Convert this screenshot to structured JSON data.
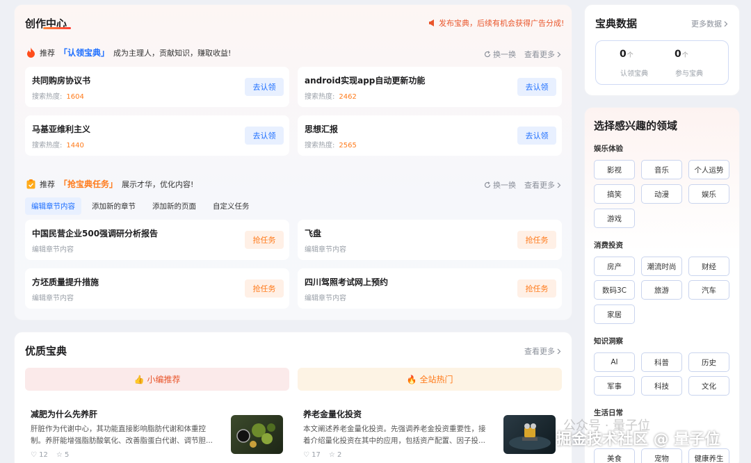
{
  "creation_center": {
    "title": "创作中心",
    "promo": "发布宝典，后续有机会获得广告分成!",
    "claim": {
      "prefix": "推荐",
      "highlight": "「认领宝典」",
      "suffix": "成为主理人，贡献知识，赚取收益!",
      "refresh": "换一换",
      "more": "查看更多",
      "heat_label": "搜索热度:",
      "button": "去认领",
      "items": [
        {
          "title": "共同购房协议书",
          "heat": "1604"
        },
        {
          "title": "android实现app自动更新功能",
          "heat": "2462"
        },
        {
          "title": "马基亚维利主义",
          "heat": "1440"
        },
        {
          "title": "思想汇报",
          "heat": "2565"
        }
      ]
    },
    "tasks": {
      "prefix": "推荐",
      "highlight": "「抢宝典任务」",
      "suffix": "展示才华，优化内容!",
      "refresh": "换一换",
      "more": "查看更多",
      "tabs": [
        "编辑章节内容",
        "添加新的章节",
        "添加新的页面",
        "自定义任务"
      ],
      "button": "抢任务",
      "items": [
        {
          "title": "中国民营企业500强调研分析报告",
          "sub": "编辑章节内容"
        },
        {
          "title": "飞盘",
          "sub": "编辑章节内容"
        },
        {
          "title": "方坯质量提升措施",
          "sub": "编辑章节内容"
        },
        {
          "title": "四川驾照考试网上预约",
          "sub": "编辑章节内容"
        }
      ]
    }
  },
  "quality": {
    "title": "优质宝典",
    "more": "查看更多",
    "banner_left": "小编推荐",
    "banner_right": "全站热门",
    "articles": [
      {
        "title": "减肥为什么先养肝",
        "desc": "肝脏作为代谢中心，其功能直接影响脂肪代谢和体重控制。养肝能增强脂肪酸氧化、改善脂蛋白代谢、调节胆...",
        "likes": "12",
        "stars": "5"
      },
      {
        "title": "养老金量化投资",
        "desc": "本文阐述养老金量化投资。先强调养老金投资重要性，接着介绍量化投资在其中的应用，包括资产配置、因子投...",
        "likes": "17",
        "stars": "2"
      }
    ]
  },
  "data_panel": {
    "title": "宝典数据",
    "more": "更多数据",
    "claimed": {
      "value": "0",
      "unit": "个",
      "label": "认领宝典"
    },
    "joined": {
      "value": "0",
      "unit": "个",
      "label": "参与宝典"
    }
  },
  "interests": {
    "title": "选择感兴趣的领域",
    "groups": [
      {
        "name": "娱乐体验",
        "chips": [
          "影视",
          "音乐",
          "个人运势",
          "搞笑",
          "动漫",
          "娱乐",
          "游戏"
        ]
      },
      {
        "name": "消费投资",
        "chips": [
          "房产",
          "潮流时尚",
          "财经",
          "数码3C",
          "旅游",
          "汽车",
          "家居"
        ]
      },
      {
        "name": "知识洞察",
        "chips": [
          "AI",
          "科普",
          "历史",
          "军事",
          "科技",
          "文化"
        ]
      },
      {
        "name": "生活日常",
        "chips": [
          "美食",
          "宠物",
          "健康养生"
        ]
      }
    ]
  },
  "watermark": {
    "text": "掘金技术社区 @ 量子位",
    "faint": "公众号 · 量子位"
  }
}
